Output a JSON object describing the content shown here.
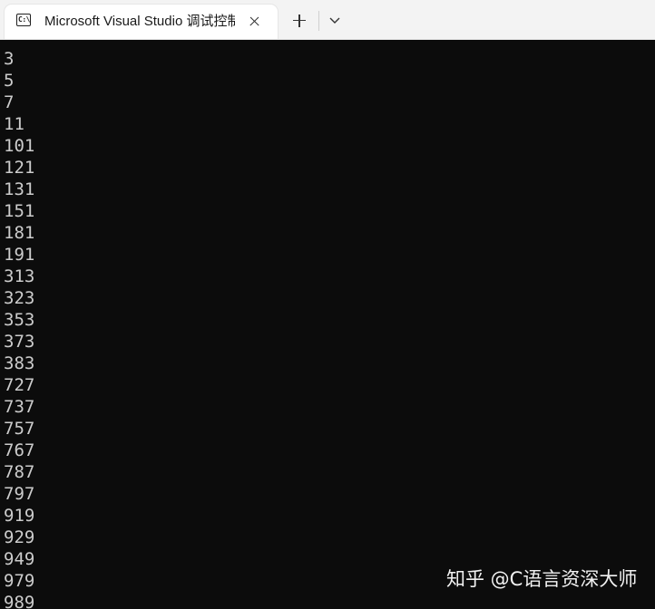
{
  "tab": {
    "icon": "console-icon",
    "icon_glyph": "C:\\",
    "title": "Microsoft Visual Studio 调试控制台",
    "close_icon": "close-icon"
  },
  "toolbar": {
    "new_tab_icon": "plus-icon",
    "dropdown_icon": "chevron-down-icon"
  },
  "console": {
    "background": "#0c0c0c",
    "text_color": "#cccccc",
    "lines": [
      "3",
      "5",
      "7",
      "11",
      "101",
      "121",
      "131",
      "151",
      "181",
      "191",
      "313",
      "323",
      "353",
      "373",
      "383",
      "727",
      "737",
      "757",
      "767",
      "787",
      "797",
      "919",
      "929",
      "949",
      "979",
      "989"
    ]
  },
  "watermark": {
    "text": "知乎 @C语言资深大师"
  }
}
